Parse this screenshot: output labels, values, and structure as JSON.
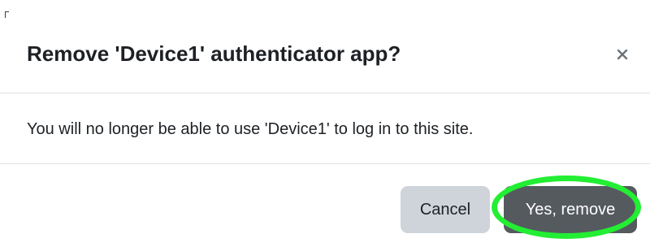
{
  "dialog": {
    "title": "Remove 'Device1' authenticator app?",
    "close_label": "×",
    "body_text": "You will no longer be able to use 'Device1' to log in to this site.",
    "buttons": {
      "cancel_label": "Cancel",
      "confirm_label": "Yes, remove"
    }
  },
  "icons": {
    "close": "close-icon"
  },
  "colors": {
    "cancel_bg": "#ced4da",
    "confirm_bg": "#555a5f",
    "highlight": "#22ee33",
    "divider": "#dee2e6"
  }
}
